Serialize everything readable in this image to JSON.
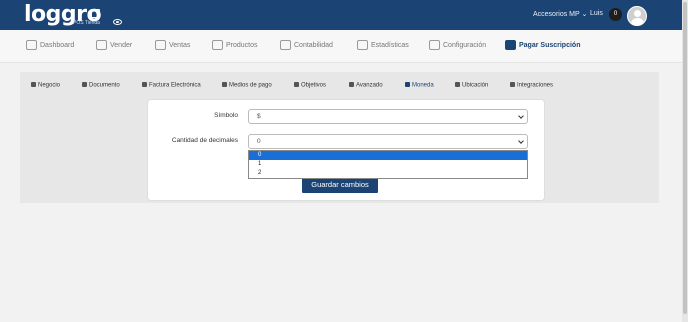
{
  "header": {
    "logo_text": "loggro",
    "logo_sub": "POS Tienda",
    "store_menu": "Accesorios MP",
    "user_name": "Luis",
    "notif_count": "0"
  },
  "nav": [
    {
      "label": "Dashboard",
      "icon": "dashboard-icon"
    },
    {
      "label": "Vender",
      "icon": "cart-icon"
    },
    {
      "label": "Ventas",
      "icon": "sales-icon"
    },
    {
      "label": "Productos",
      "icon": "box-icon"
    },
    {
      "label": "Contabilidad",
      "icon": "book-icon"
    },
    {
      "label": "Estadísticas",
      "icon": "stats-icon"
    },
    {
      "label": "Configuración",
      "icon": "gear-icon"
    },
    {
      "label": "Pagar Suscripción",
      "icon": "card-icon"
    }
  ],
  "tabs": [
    {
      "label": "Negocio",
      "icon": "building-icon"
    },
    {
      "label": "Documento",
      "icon": "document-icon"
    },
    {
      "label": "Factura Electrónica",
      "icon": "invoice-icon"
    },
    {
      "label": "Medios de pago",
      "icon": "payment-icon"
    },
    {
      "label": "Objetivos",
      "icon": "target-icon"
    },
    {
      "label": "Avanzado",
      "icon": "bell-icon"
    },
    {
      "label": "Moneda",
      "icon": "dollar-icon"
    },
    {
      "label": "Ubicación",
      "icon": "location-icon"
    },
    {
      "label": "Integraciones",
      "icon": "integration-icon"
    }
  ],
  "form": {
    "symbol_label": "Símbolo",
    "symbol_value": "$",
    "decimals_label": "Cantidad de decimales",
    "decimals_value": "0",
    "decimals_options": [
      "0",
      "1",
      "2"
    ],
    "save_label": "Guardar cambios"
  },
  "colors": {
    "brand": "#1b4474",
    "selected_option": "#1a6fd6"
  }
}
